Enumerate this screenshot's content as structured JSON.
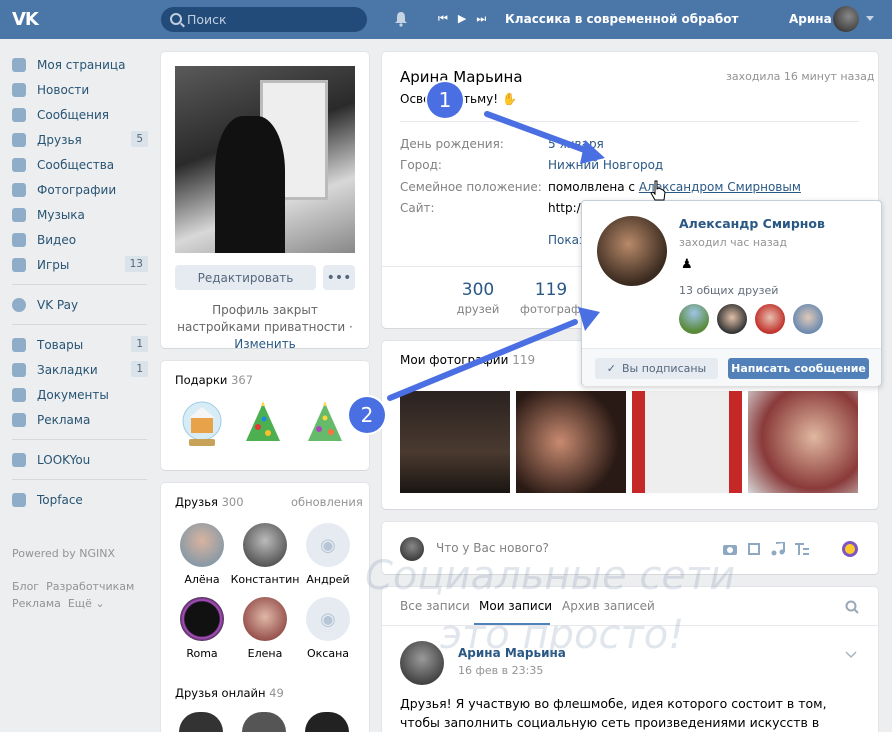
{
  "colors": {
    "brand": "#4a76a8",
    "link": "#2a5885",
    "accent_button": "#5181b8",
    "annotation": "#4a6fe3"
  },
  "header": {
    "search_placeholder": "Поиск",
    "track": "Классика в современной обработ",
    "user": "Арина",
    "player_prev": "⏮",
    "player_play": "▶",
    "player_next": "⏭"
  },
  "menu": {
    "items": [
      {
        "label": "Моя страница",
        "icon": "home-icon"
      },
      {
        "label": "Новости",
        "icon": "news-icon"
      },
      {
        "label": "Сообщения",
        "icon": "messages-icon"
      },
      {
        "label": "Друзья",
        "icon": "friends-icon",
        "count": "5"
      },
      {
        "label": "Сообщества",
        "icon": "groups-icon"
      },
      {
        "label": "Фотографии",
        "icon": "camera-icon"
      },
      {
        "label": "Музыка",
        "icon": "music-icon"
      },
      {
        "label": "Видео",
        "icon": "video-icon"
      },
      {
        "label": "Игры",
        "icon": "games-icon",
        "count": "13"
      }
    ],
    "vkpay": "VK Pay",
    "items2": [
      {
        "label": "Товары",
        "icon": "bag-icon",
        "count": "1"
      },
      {
        "label": "Закладки",
        "icon": "star-icon",
        "count": "1"
      },
      {
        "label": "Документы",
        "icon": "document-icon"
      },
      {
        "label": "Реклама",
        "icon": "megaphone-icon"
      }
    ],
    "lookyou": "LOOKYou",
    "topface": "Topface",
    "powered": "Powered by NGINX",
    "footer": {
      "blog": "Блог",
      "devs": "Разработчикам",
      "ads": "Реклама",
      "more": "Ещё"
    }
  },
  "left": {
    "edit": "Редактировать",
    "more": "•••",
    "closed_text": "Профиль закрыт настройками приватности",
    "closed_sep": "·",
    "change": "Изменить",
    "gifts_title": "Подарки",
    "gifts_count": "367",
    "friends_title": "Друзья",
    "friends_count": "300",
    "friends_updates": "обновления",
    "friends": [
      "Алёна",
      "Константин",
      "Андрей",
      "Roma",
      "Елена",
      "Оксана"
    ],
    "online_title": "Друзья онлайн",
    "online_count": "49"
  },
  "profile": {
    "name": "Арина Марьина",
    "last_seen": "заходила 16 минут назад",
    "status": "Освещаю тьму!",
    "birthday_label": "День рождения:",
    "birthday_value": "5 января",
    "city_label": "Город:",
    "city_value": "Нижний Новгород",
    "family_label": "Семейное положение:",
    "family_value": "помолвлена с",
    "family_link": "Александром Смирновым",
    "site_label": "Сайт:",
    "site_value": "http://",
    "show_more": "Показ",
    "stats": [
      {
        "n": "300",
        "l": "друзей"
      },
      {
        "n": "119",
        "l": "фотографи"
      }
    ]
  },
  "photos": {
    "title": "Мои фотографии",
    "count": "119"
  },
  "composer": {
    "placeholder": "Что у Вас нового?"
  },
  "tabs": [
    "Все записи",
    "Мои записи",
    "Архив записей"
  ],
  "post": {
    "author": "Арина Марьина",
    "date": "16 фев в 23:35",
    "text": "Друзья! Я участвую во флешмобе, идея которого состоит в том, чтобы заполнить социальную сеть произведениями искусств в противовес фотографиям тел,"
  },
  "popup": {
    "name": "Александр Смирнов",
    "last_seen": "заходил час назад",
    "chess": "♟",
    "mutual": "13 общих друзей",
    "subscribed": "Вы подписаны",
    "message": "Написать сообщение"
  },
  "annotations": {
    "one": "1",
    "two": "2"
  },
  "watermark": {
    "line1": "Социальные сети",
    "line2": "это просто!"
  }
}
